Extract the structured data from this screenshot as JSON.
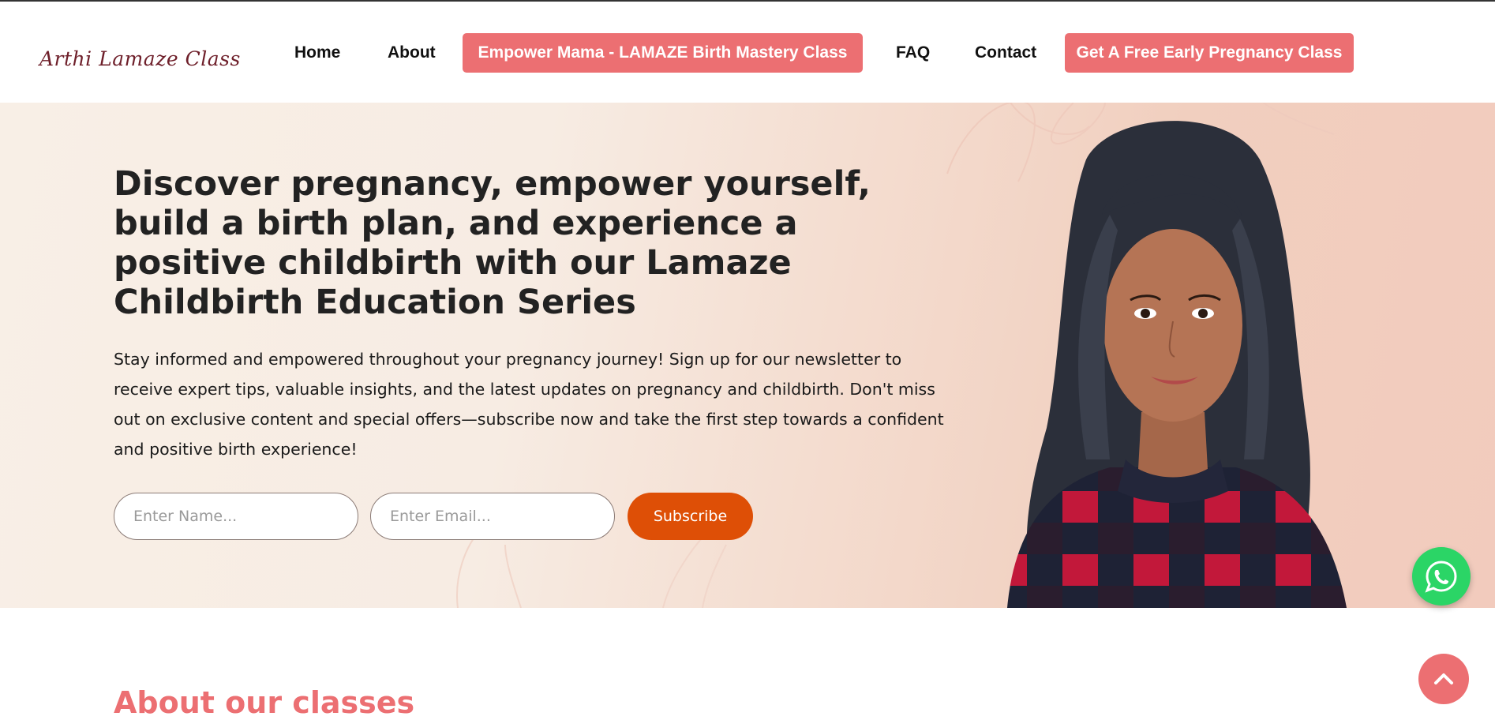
{
  "brand": {
    "logo_text": "Arthi Lamaze Class",
    "accent_color": "#ec6f72",
    "cta_color": "#de4f06"
  },
  "nav": {
    "items": [
      "Home",
      "About",
      "Empower Mama - LAMAZE Birth Mastery Class",
      "FAQ",
      "Contact",
      "Get A Free Early Pregnancy Class"
    ]
  },
  "hero": {
    "headline": "Discover pregnancy, empower yourself, build a birth plan, and experience a positive childbirth with our Lamaze Childbirth Education Series",
    "paragraph": "Stay informed and empowered throughout your pregnancy journey! Sign up for our newsletter to receive expert tips, valuable insights, and the latest updates on pregnancy and childbirth. Don't miss out on exclusive content and special offers—subscribe now and take the first step towards a confident and positive birth experience!",
    "name_placeholder": "Enter Name...",
    "email_placeholder": "Enter Email...",
    "subscribe_label": "Subscribe"
  },
  "about": {
    "title": "About our classes"
  },
  "floating": {
    "whatsapp_icon": "whatsapp-icon",
    "top_icon": "chevron-up-icon"
  }
}
